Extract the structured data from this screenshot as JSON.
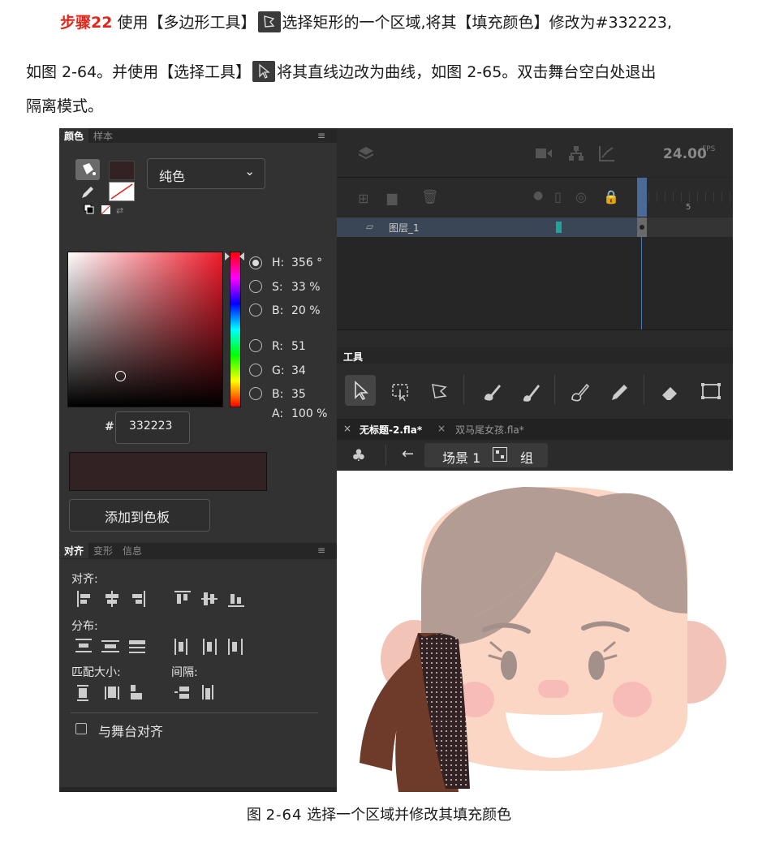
{
  "text": {
    "step_label": "步骤22",
    "line1": "使用【多边形工具】",
    "line1b": "选择矩形的一个区域,将其【填充颜色】修改为#332223,",
    "line2a": "如图 2-64。并使用【选择工具】",
    "line2b": "将其直线边改为曲线，如图 2-65。双击舞台空白处退出",
    "line3": "隔离模式。",
    "caption_prefix": "图",
    "caption_num": "2-64",
    "caption_text": "选择一个区域并修改其填充颜色"
  },
  "color_panel": {
    "tab_color": "颜色",
    "tab_swatch": "样本",
    "fill_type": "纯色",
    "h_label": "H:",
    "h_value": "356 °",
    "s_label": "S:",
    "s_value": "33 %",
    "b_label": "B:",
    "b_value": "20 %",
    "r_label": "R:",
    "r_value": "51",
    "g_label": "G:",
    "g_value": "34",
    "bl_label": "B:",
    "bl_value": "35",
    "a_label": "A:",
    "a_value": "100 %",
    "hex_prefix": "#",
    "hex_value": "332223",
    "add_swatch": "添加到色板",
    "fill_color": "#332223"
  },
  "align_panel": {
    "tab_align": "对齐",
    "tab_transform": "变形",
    "tab_info": "信息",
    "align_label": "对齐:",
    "distribute_label": "分布:",
    "match_size_label": "匹配大小:",
    "spacing_label": "间隔:",
    "align_to_stage": "与舞台对齐"
  },
  "timeline": {
    "fps": "24.00",
    "fps_unit": "FPS",
    "layer_name": "图层_1",
    "frame_marker": "5"
  },
  "tools_panel": {
    "title": "工具"
  },
  "doc_tabs": [
    {
      "label": "无标题-2.fla*",
      "active": true
    },
    {
      "label": "双马尾女孩.fla*",
      "active": false
    }
  ],
  "scene_bar": {
    "scene": "场景 1",
    "group": "组"
  },
  "colors": {
    "accent": "#e0261a",
    "hair": "#b39c94",
    "face": "#fcd6c4",
    "ear": "#f2c4b8",
    "brown": "#6e3a2a",
    "selected_fill": "#332223"
  }
}
